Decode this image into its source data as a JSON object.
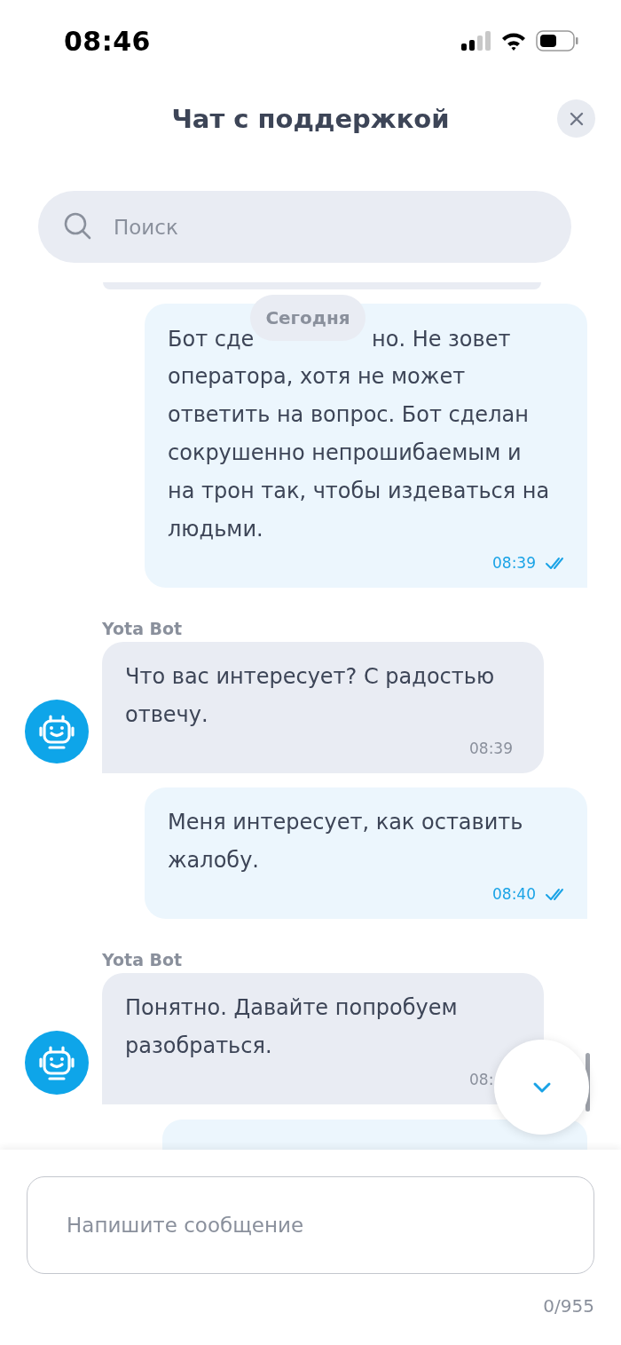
{
  "status_bar": {
    "time": "08:46"
  },
  "header": {
    "title": "Чат с поддержкой"
  },
  "search": {
    "placeholder": "Поиск"
  },
  "date_badge": "Сегодня",
  "messages": [
    {
      "kind": "incoming",
      "partial": true
    },
    {
      "kind": "outgoing",
      "partial": false,
      "covered_line": [
        "Бот сде",
        "но. Не зовет"
      ],
      "text": "оператора, хотя не может ответить на вопрос. Бот сделан сокрушенно непрошибаемым и на трон так, чтобы издеваться на людьми.",
      "time": "08:39",
      "read": true
    },
    {
      "kind": "incoming",
      "partial": false,
      "sender": "Yota Bot",
      "text": "Что вас интересует? С радостью отвечу.",
      "time": "08:39"
    },
    {
      "kind": "outgoing",
      "partial": false,
      "text": "Меня интересует, как оставить жалобу.",
      "time": "08:40",
      "read": true
    },
    {
      "kind": "incoming",
      "partial": false,
      "sender": "Yota Bot",
      "text": "Понятно. Давайте попробуем разобраться.",
      "time": "08:"
    },
    {
      "kind": "outgoing",
      "partial": true
    }
  ],
  "composer": {
    "placeholder": "Напишите сообщение",
    "counter": "0/955"
  }
}
